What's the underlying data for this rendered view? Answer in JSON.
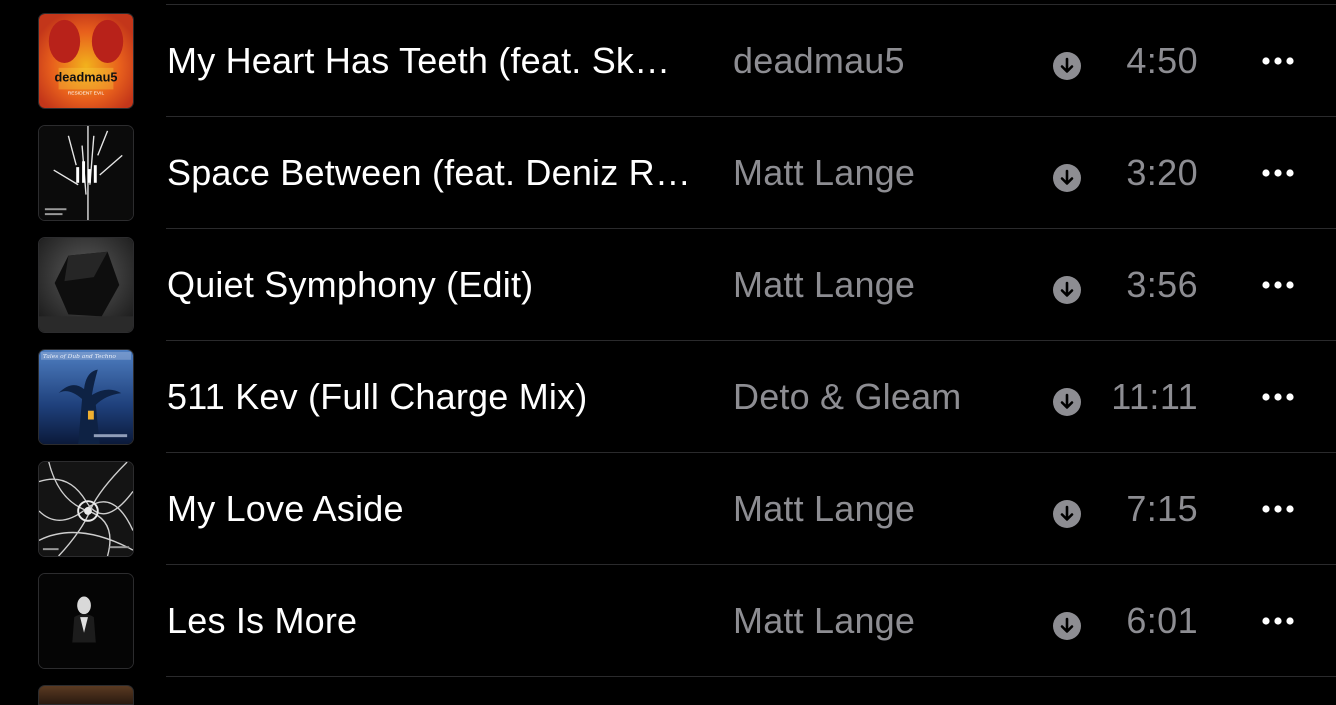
{
  "tracks": [
    {
      "title": "My Heart Has Teeth (feat. Sk…",
      "artist": "deadmau5",
      "duration": "4:50",
      "art": "album-art-resident-evil",
      "art_text": "deadmau5",
      "art_subtext": "RESIDENT EVIL",
      "downloaded": true
    },
    {
      "title": "Space Between (feat. Deniz R…",
      "artist": "Matt Lange",
      "duration": "3:20",
      "art": "album-art-space-between",
      "downloaded": true
    },
    {
      "title": "Quiet Symphony (Edit)",
      "artist": "Matt Lange",
      "duration": "3:56",
      "art": "album-art-quiet-symphony",
      "downloaded": true
    },
    {
      "title": "511 Kev (Full Charge Mix)",
      "artist": "Deto & Gleam",
      "duration": "11:11",
      "art": "album-art-tales-of-dub",
      "art_text": "Tales of Dub and Techno",
      "downloaded": true
    },
    {
      "title": "My Love Aside",
      "artist": "Matt Lange",
      "duration": "7:15",
      "art": "album-art-my-love-aside",
      "downloaded": true
    },
    {
      "title": "Les Is More",
      "artist": "Matt Lange",
      "duration": "6:01",
      "art": "album-art-les-is-more",
      "downloaded": true
    }
  ],
  "icons": {
    "download": "download-icon",
    "more": "more-options-icon"
  },
  "colors": {
    "background": "#000000",
    "title_text": "#ffffff",
    "secondary_text": "#8d8d92",
    "divider": "#2a2a2c",
    "icon": "#8d8d92"
  }
}
